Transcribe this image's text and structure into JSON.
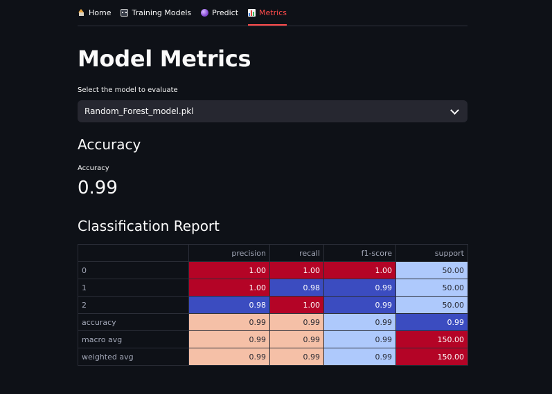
{
  "tabs": [
    {
      "label": "Home",
      "icon": "home-icon",
      "active": false
    },
    {
      "label": "Training Models",
      "icon": "robot-icon",
      "active": false
    },
    {
      "label": "Predict",
      "icon": "crystal-ball-icon",
      "active": false
    },
    {
      "label": "Metrics",
      "icon": "bar-chart-icon",
      "active": true
    }
  ],
  "page": {
    "title": "Model Metrics",
    "select_label": "Select the model to evaluate",
    "select_value": "Random_Forest_model.pkl"
  },
  "accuracy_section": {
    "heading": "Accuracy",
    "metric_label": "Accuracy",
    "metric_value": "0.99"
  },
  "report_section": {
    "heading": "Classification Report"
  },
  "classification_report": {
    "columns": [
      "",
      "precision",
      "recall",
      "f1-score",
      "support"
    ],
    "rows": [
      {
        "label": "0",
        "cells": [
          {
            "v": "1.00",
            "c": "#b40426"
          },
          {
            "v": "1.00",
            "c": "#b40426"
          },
          {
            "v": "1.00",
            "c": "#b40426"
          },
          {
            "v": "50.00",
            "c": "#aec9fc"
          }
        ]
      },
      {
        "label": "1",
        "cells": [
          {
            "v": "1.00",
            "c": "#b40426"
          },
          {
            "v": "0.98",
            "c": "#3b4cc0"
          },
          {
            "v": "0.99",
            "c": "#3b4cc0"
          },
          {
            "v": "50.00",
            "c": "#aec9fc"
          }
        ]
      },
      {
        "label": "2",
        "cells": [
          {
            "v": "0.98",
            "c": "#3b4cc0"
          },
          {
            "v": "1.00",
            "c": "#b40426"
          },
          {
            "v": "0.99",
            "c": "#3b4cc0"
          },
          {
            "v": "50.00",
            "c": "#aec9fc"
          }
        ]
      },
      {
        "label": "accuracy",
        "cells": [
          {
            "v": "0.99",
            "c": "#f5c0a7"
          },
          {
            "v": "0.99",
            "c": "#f5c0a7"
          },
          {
            "v": "0.99",
            "c": "#aec9fc"
          },
          {
            "v": "0.99",
            "c": "#3b4cc0"
          }
        ]
      },
      {
        "label": "macro avg",
        "cells": [
          {
            "v": "0.99",
            "c": "#f5c0a7"
          },
          {
            "v": "0.99",
            "c": "#f5c0a7"
          },
          {
            "v": "0.99",
            "c": "#aec9fc"
          },
          {
            "v": "150.00",
            "c": "#b40426"
          }
        ]
      },
      {
        "label": "weighted avg",
        "cells": [
          {
            "v": "0.99",
            "c": "#f5c0a7"
          },
          {
            "v": "0.99",
            "c": "#f5c0a7"
          },
          {
            "v": "0.99",
            "c": "#aec9fc"
          },
          {
            "v": "150.00",
            "c": "#b40426"
          }
        ]
      }
    ]
  },
  "colors": {
    "background": "#0e1117",
    "accent": "#ff4b4b",
    "input_bg": "#262730"
  }
}
